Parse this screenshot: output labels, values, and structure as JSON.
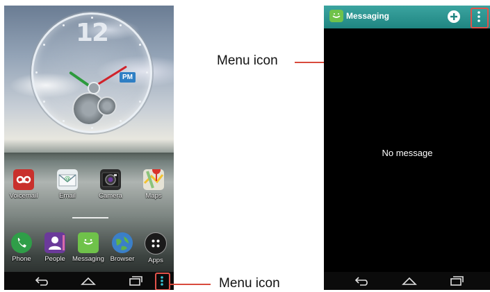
{
  "home_screen": {
    "clock": {
      "hour_label": "12",
      "period_badge": "PM"
    },
    "dock_row_1": [
      {
        "label": "Voicemail",
        "icon": "voicemail-icon",
        "color": "#c9302c"
      },
      {
        "label": "Email",
        "icon": "email-icon",
        "color": "#e9eef0"
      },
      {
        "label": "Camera",
        "icon": "camera-icon",
        "color": "#2a2a2a"
      },
      {
        "label": "Maps",
        "icon": "maps-icon",
        "color": "#e6e3d6"
      }
    ],
    "dock_row_2": [
      {
        "label": "Phone",
        "icon": "phone-icon",
        "color": "#2f9e48"
      },
      {
        "label": "People",
        "icon": "people-icon",
        "color": "#6b3a9a"
      },
      {
        "label": "Messaging",
        "icon": "messaging-icon",
        "color": "#6fc24a"
      },
      {
        "label": "Browser",
        "icon": "browser-icon",
        "color": "#3b7fc8"
      },
      {
        "label": "Apps",
        "icon": "apps-icon",
        "color": "#1a1a1a"
      }
    ],
    "nav_bar": {
      "back": "back-icon",
      "home": "home-icon",
      "recents": "recents-icon",
      "menu": "menu-icon"
    }
  },
  "messaging_screen": {
    "title": "Messaging",
    "new_message": "plus-icon",
    "menu": "menu-icon",
    "empty_state": "No message",
    "nav_bar": {
      "back": "back-icon",
      "home": "home-icon",
      "recents": "recents-icon"
    }
  },
  "callouts": {
    "top": "Menu icon",
    "bottom": "Menu icon",
    "accent_color": "#d84a3c"
  }
}
